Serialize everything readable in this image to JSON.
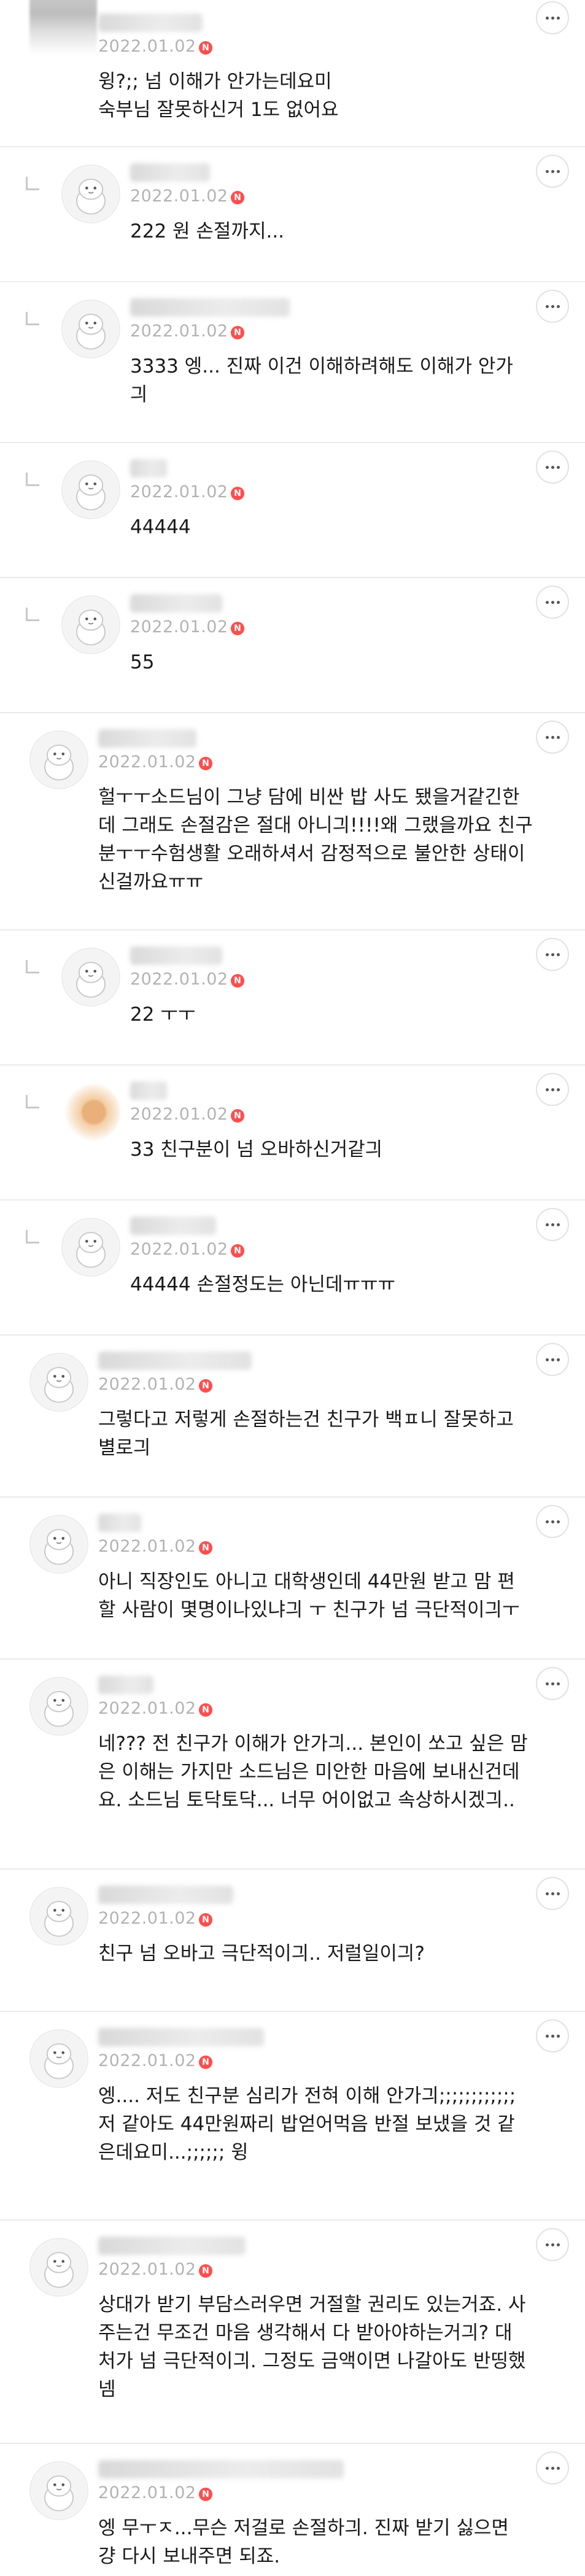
{
  "new_badge_label": "N",
  "comments": [
    {
      "date": "2022.01.02",
      "text": "윙?;; 넘 이해가 안가는데요미\n숙부님 잘못하신거 1도 없어요",
      "is_reply": false,
      "avatar_icon": "blurred-profile-photo"
    },
    {
      "date": "2022.01.02",
      "text": "222 원 손절까지...",
      "is_reply": true,
      "avatar_icon": "default-profile-icon"
    },
    {
      "date": "2022.01.02",
      "text": "3333 엥... 진짜 이건 이해하려해도 이해가 안가\n긔",
      "is_reply": true,
      "avatar_icon": "default-profile-icon"
    },
    {
      "date": "2022.01.02",
      "text": "44444",
      "is_reply": true,
      "avatar_icon": "default-profile-icon"
    },
    {
      "date": "2022.01.02",
      "text": "55",
      "is_reply": true,
      "avatar_icon": "default-profile-icon"
    },
    {
      "date": "2022.01.02",
      "text": "헐ㅜㅜ소드님이 그냥 담에 비싼 밥 사도 됐을거같긴한\n데 그래도 손절감은 절대 아니긔!!!!왜 그랬을까요 친구\n분ㅜㅜ수험생활 오래하셔서 감정적으로 불안한 상태이\n신걸까요ㅠㅠ",
      "is_reply": false,
      "avatar_icon": "default-profile-icon"
    },
    {
      "date": "2022.01.02",
      "text": "22 ㅜㅜ",
      "is_reply": true,
      "avatar_icon": "default-profile-icon"
    },
    {
      "date": "2022.01.02",
      "text": "33 친구분이 넘 오바하신거같긔",
      "is_reply": true,
      "avatar_icon": "blurred-profile-photo"
    },
    {
      "date": "2022.01.02",
      "text": "44444 손절정도는 아닌데ㅠㅠㅠ",
      "is_reply": true,
      "avatar_icon": "default-profile-icon"
    },
    {
      "date": "2022.01.02",
      "text": "그렇다고 저렇게 손절하는건 친구가 백ㅍ니 잘못하고\n별로긔",
      "is_reply": false,
      "avatar_icon": "default-profile-icon"
    },
    {
      "date": "2022.01.02",
      "text": "아니 직장인도 아니고 대학생인데 44만원 받고 맘 편\n할 사람이 몇명이나있냐긔 ㅜ 친구가 넘 극단적이긔ㅜ",
      "is_reply": false,
      "avatar_icon": "default-profile-icon"
    },
    {
      "date": "2022.01.02",
      "text": "네??? 전 친구가 이해가 안가긔... 본인이 쏘고 싶은 맘\n은 이해는 가지만 소드님은 미안한 마음에 보내신건데\n요. 소드님 토닥토닥... 너무 어이없고 속상하시겠긔..",
      "is_reply": false,
      "avatar_icon": "default-profile-icon"
    },
    {
      "date": "2022.01.02",
      "text": "친구 넘 오바고 극단적이긔.. 저럴일이긔?",
      "is_reply": false,
      "avatar_icon": "default-profile-icon"
    },
    {
      "date": "2022.01.02",
      "text": "엥.... 저도 친구분 심리가 전혀 이해 안가긔;;;;;;;;;;;;\n저 같아도 44만원짜리 밥얻어먹음 반절 보냈을 것 같\n은데요미...;;;;;; 윙",
      "is_reply": false,
      "avatar_icon": "default-profile-icon"
    },
    {
      "date": "2022.01.02",
      "text": "상대가 받기 부담스러우면 거절할 권리도 있는거죠. 사\n주는건 무조건 마음 생각해서 다 받아야하는거긔? 대\n처가 넘 극단적이긔. 그정도 금액이면 나갈아도 반띵했\n넴",
      "is_reply": false,
      "avatar_icon": "default-profile-icon"
    },
    {
      "date": "2022.01.02",
      "text": "엥 무ㅜㅈ...무슨 저걸로 손절하긔. 진짜 받기 싫으면\n걍 다시 보내주면 되죠.",
      "is_reply": false,
      "avatar_icon": "default-profile-icon"
    }
  ]
}
